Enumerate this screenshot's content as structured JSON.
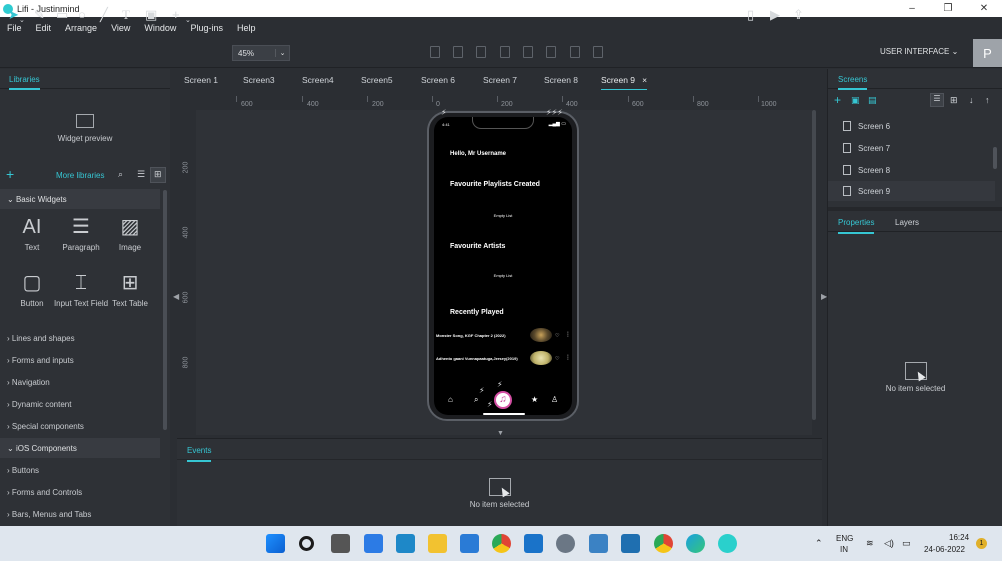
{
  "window": {
    "title": "Lifi - Justinmind",
    "min": "–",
    "max": "❐",
    "close": "✕"
  },
  "menu": [
    "File",
    "Edit",
    "Arrange",
    "View",
    "Window",
    "Plug-ins",
    "Help"
  ],
  "toolbar": {
    "zoom": "45%",
    "mode": "USER INTERFACE",
    "mode_caret": "⌄",
    "avatar": "P"
  },
  "left_panel": {
    "tab": "Libraries",
    "widget_preview": "Widget preview",
    "more_libraries": "More libraries",
    "basic_widgets": "Basic Widgets",
    "widgets": [
      "Text",
      "Paragraph",
      "Image",
      "Button",
      "Input Text Field",
      "Text Table"
    ],
    "categories": [
      "Lines and shapes",
      "Forms and inputs",
      "Navigation",
      "Dynamic content",
      "Special components"
    ],
    "ios_components": "iOS Components",
    "ios_categories": [
      "Buttons",
      "Forms and Controls",
      "Bars, Menus and Tabs"
    ]
  },
  "tabs": [
    "Screen 1",
    "Screen3",
    "Screen4",
    "Screen5",
    "Screen 6",
    "Screen 7",
    "Screen 8",
    "Screen 9"
  ],
  "tab_close": "×",
  "ruler_h": [
    "600",
    "400",
    "200",
    "0",
    "200",
    "400",
    "600",
    "800",
    "1000"
  ],
  "ruler_v": [
    "200",
    "400",
    "600",
    "800"
  ],
  "phone": {
    "time": "4:41",
    "greeting": "Hello, Mr Username",
    "playlists_title": "Favourite Playlists Created",
    "playlists_empty": "Empty List",
    "artists_title": "Favourite Artists",
    "artists_empty": "Empty List",
    "recent_title": "Recently Played",
    "songs": [
      "Monster Song, KGF Chapter 2 (2022)",
      "Adhento gaani Vunnapaatuga,Jersey(2019)"
    ]
  },
  "events": {
    "tab": "Events",
    "empty": "No item selected"
  },
  "right_panel": {
    "tab": "Screens",
    "screens": [
      "Screen 6",
      "Screen 7",
      "Screen 8",
      "Screen 9"
    ],
    "properties_tab": "Properties",
    "layers_tab": "Layers",
    "empty": "No item selected"
  },
  "taskbar": {
    "lang": "ENG",
    "region": "IN",
    "time": "16:24",
    "date": "24-06-2022",
    "notif": "1"
  }
}
